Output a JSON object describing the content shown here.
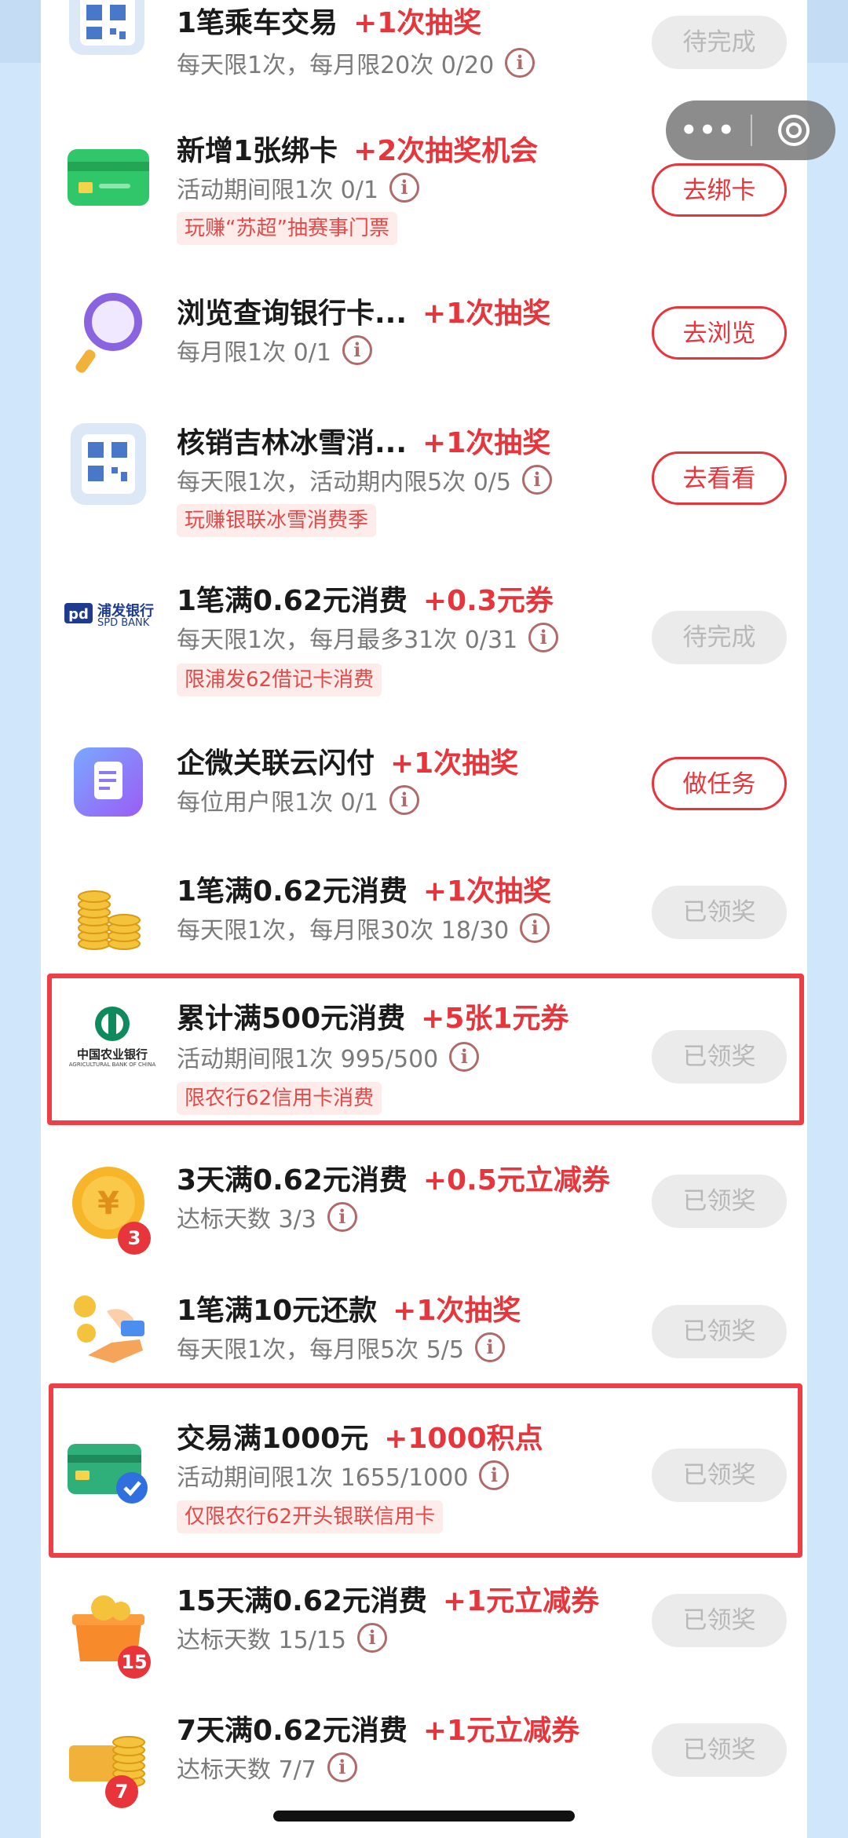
{
  "tasks": [
    {
      "title": "1笔乘车交易",
      "reward": "+1次抽奖",
      "sub": "每天限1次，每月限20次 0/20",
      "tag": "",
      "button": "待完成"
    },
    {
      "title": "新增1张绑卡",
      "reward": "+2次抽奖机会",
      "sub": "活动期间限1次 0/1",
      "tag": "玩赚“苏超”抽赛事门票",
      "button": "去绑卡"
    },
    {
      "title": "浏览查询银行卡...",
      "reward": "+1次抽奖",
      "sub": "每月限1次 0/1",
      "tag": "",
      "button": "去浏览"
    },
    {
      "title": "核销吉林冰雪消...",
      "reward": "+1次抽奖",
      "sub": "每天限1次，活动期内限5次 0/5",
      "tag": "玩赚银联冰雪消费季",
      "button": "去看看"
    },
    {
      "title": "1笔满0.62元消费",
      "reward": "+0.3元券",
      "sub": "每天限1次，每月最多31次 0/31",
      "tag": "限浦发62借记卡消费",
      "button": "待完成"
    },
    {
      "title": "企微关联云闪付",
      "reward": "+1次抽奖",
      "sub": "每位用户限1次 0/1",
      "tag": "",
      "button": "做任务"
    },
    {
      "title": "1笔满0.62元消费",
      "reward": "+1次抽奖",
      "sub": "每天限1次，每月限30次 18/30",
      "tag": "",
      "button": "已领奖"
    },
    {
      "title": "累计满500元消费",
      "reward": "+5张1元券",
      "sub": "活动期间限1次 995/500",
      "tag": "限农行62信用卡消费",
      "button": "已领奖"
    },
    {
      "title": "3天满0.62元消费",
      "reward": "+0.5元立减券",
      "sub": "达标天数 3/3",
      "tag": "",
      "button": "已领奖"
    },
    {
      "title": "1笔满10元还款",
      "reward": "+1次抽奖",
      "sub": "每天限1次，每月限5次 5/5",
      "tag": "",
      "button": "已领奖"
    },
    {
      "title": "交易满1000元",
      "reward": "+1000积点",
      "sub": "活动期间限1次 1655/1000",
      "tag": "仅限农行62开头银联信用卡",
      "button": "已领奖"
    },
    {
      "title": "15天满0.62元消费",
      "reward": "+1元立减券",
      "sub": "达标天数 15/15",
      "tag": "",
      "button": "已领奖"
    },
    {
      "title": "7天满0.62元消费",
      "reward": "+1元立减券",
      "sub": "达标天数 7/7",
      "tag": "",
      "button": "已领奖"
    }
  ],
  "logos": {
    "spdb_cn": "浦发银行",
    "spdb_en": "SPD BANK",
    "abc_cn": "中国农业银行",
    "abc_en": "AGRICULTURAL BANK OF CHINA"
  },
  "badges": {
    "coin3": "3",
    "gift15": "15",
    "coins7": "7"
  },
  "info_glyph": "i",
  "capsule": {
    "more": "•••"
  },
  "colors": {
    "accent": "#e8353b",
    "background": "#cfe6fb",
    "tag_bg": "#fdecea",
    "done_bg": "#ebebeb"
  }
}
